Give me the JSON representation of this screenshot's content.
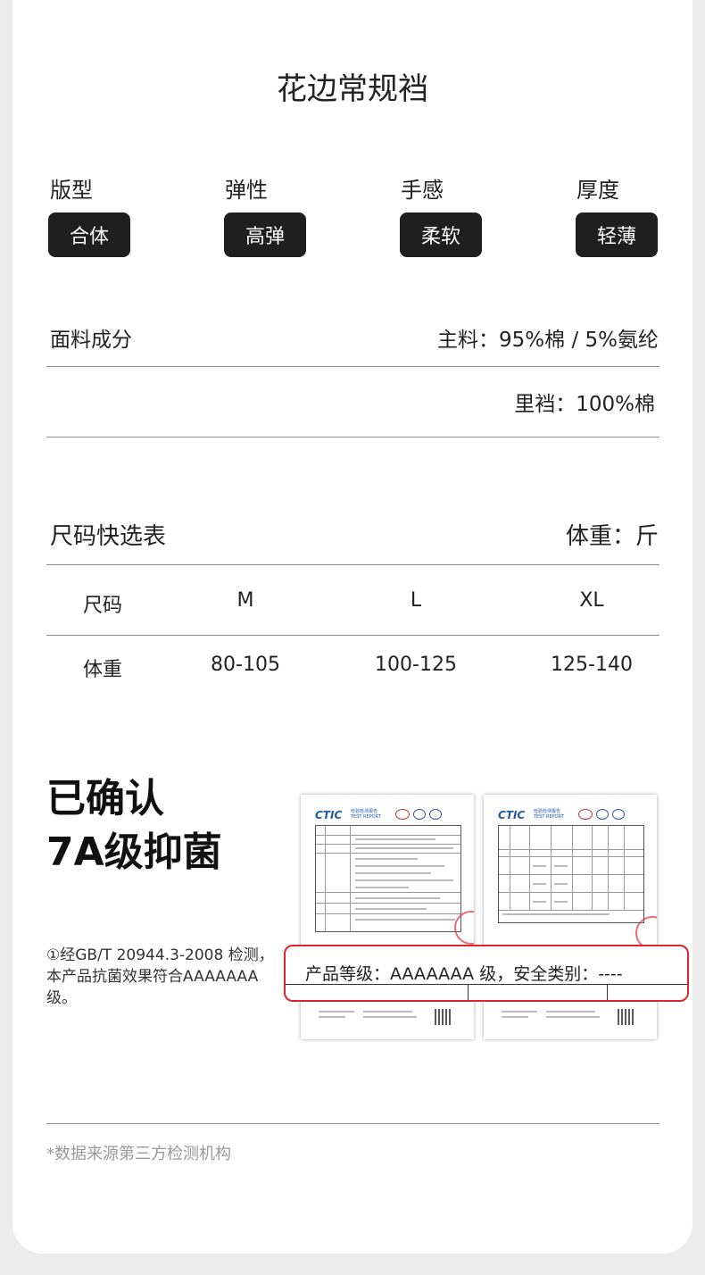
{
  "title": "花边常规裆",
  "attributes": [
    {
      "label": "版型",
      "value": "合体"
    },
    {
      "label": "弹性",
      "value": "高弹"
    },
    {
      "label": "手感",
      "value": "柔软"
    },
    {
      "label": "厚度",
      "value": "轻薄"
    }
  ],
  "fabric": {
    "label": "面料成分",
    "main": "主料：95%棉 / 5%氨纶",
    "crotch": "里裆：100%棉"
  },
  "size_table": {
    "title": "尺码快选表",
    "unit": "体重：斤",
    "header": [
      "尺码",
      "M",
      "L",
      "XL"
    ],
    "row": [
      "体重",
      "80-105",
      "100-125",
      "125-140"
    ]
  },
  "antibacterial": {
    "line1": "已确认",
    "line2": "7A级抑菌",
    "note": "①经GB/T 20944.3-2008 检测，本产品抗菌效果符合AAAAAAA级。",
    "highlight": "产品等级：AAAAAAA 级，安全类别：----",
    "report_brand": "CTIC",
    "report_cn": "检验检测报告",
    "report_en": "TEST REPORT"
  },
  "source": "*数据来源第三方检测机构",
  "colors": {
    "pill_bg": "#1f1f1f",
    "highlight_border": "#d9262e",
    "report_blue": "#1e5aa8"
  }
}
